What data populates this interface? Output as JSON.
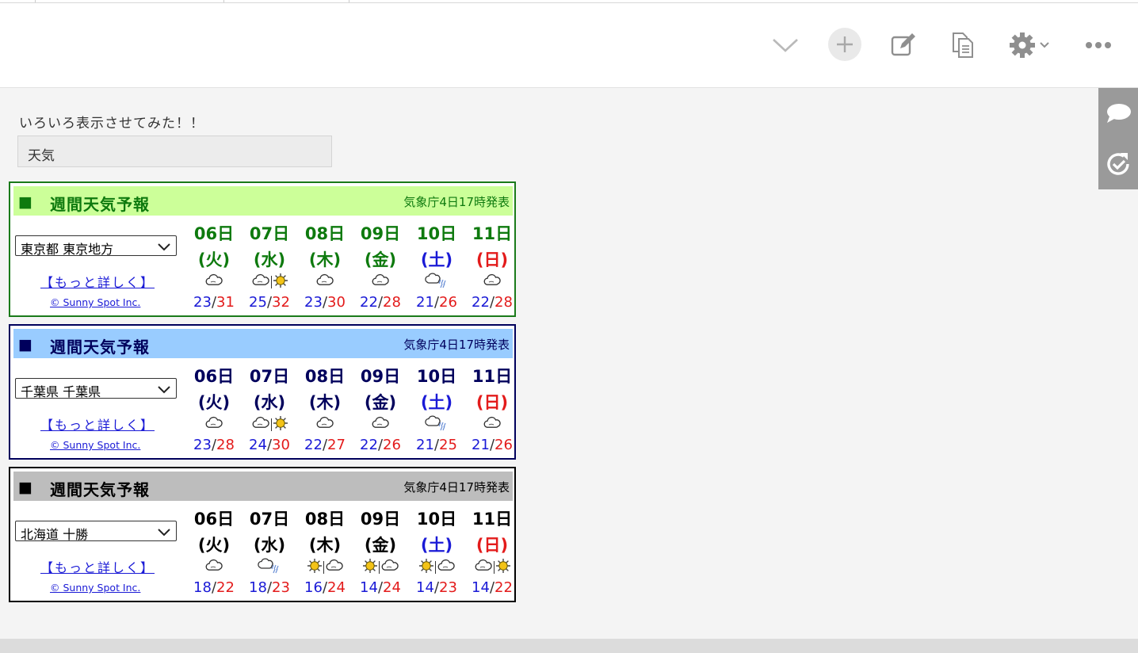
{
  "page": {
    "title": "いろいろ表示させてみた！！",
    "search_value": "天気"
  },
  "toolbar": {
    "icons": [
      "chevron-down-icon",
      "plus-icon",
      "edit-icon",
      "document-icon",
      "gear-icon",
      "more-icon"
    ]
  },
  "side_panel": {
    "icons": [
      "comment-icon",
      "refresh-icon"
    ]
  },
  "colors": {
    "green_border": "#1a7a1a",
    "green_header": "#ccff99",
    "green_text": "#0e7a0e",
    "navy_border": "#00005c",
    "blue_header": "#99ccff",
    "navy_text": "#00005c",
    "black_border": "#000000",
    "gray_header": "#bdbdbd",
    "low_temp": "#1a1ad6",
    "high_temp": "#e31b1b"
  },
  "widgets": [
    {
      "square": "■",
      "title": "週間天気予報",
      "issuer": "気象庁4日17時発表",
      "region": "東京都 東京地方",
      "more_link": "【もっと詳しく】",
      "copyright": "© Sunny Spot Inc.",
      "days": [
        {
          "date": "06日",
          "dow": "(火)",
          "dow_type": "weekday",
          "weather": [
            "cloud"
          ],
          "low": "23",
          "high": "31"
        },
        {
          "date": "07日",
          "dow": "(水)",
          "dow_type": "weekday",
          "weather": [
            "cloud",
            "sun"
          ],
          "low": "25",
          "high": "32"
        },
        {
          "date": "08日",
          "dow": "(木)",
          "dow_type": "weekday",
          "weather": [
            "cloud"
          ],
          "low": "23",
          "high": "30"
        },
        {
          "date": "09日",
          "dow": "(金)",
          "dow_type": "weekday",
          "weather": [
            "cloud"
          ],
          "low": "22",
          "high": "28"
        },
        {
          "date": "10日",
          "dow": "(土)",
          "dow_type": "saturday",
          "weather": [
            "cloud-rain"
          ],
          "low": "21",
          "high": "26"
        },
        {
          "date": "11日",
          "dow": "(日)",
          "dow_type": "sunday",
          "weather": [
            "cloud"
          ],
          "low": "22",
          "high": "28"
        }
      ]
    },
    {
      "square": "■",
      "title": "週間天気予報",
      "issuer": "気象庁4日17時発表",
      "region": "千葉県 千葉県",
      "more_link": "【もっと詳しく】",
      "copyright": "© Sunny Spot Inc.",
      "days": [
        {
          "date": "06日",
          "dow": "(火)",
          "dow_type": "weekday",
          "weather": [
            "cloud"
          ],
          "low": "23",
          "high": "28"
        },
        {
          "date": "07日",
          "dow": "(水)",
          "dow_type": "weekday",
          "weather": [
            "cloud",
            "sun"
          ],
          "low": "24",
          "high": "30"
        },
        {
          "date": "08日",
          "dow": "(木)",
          "dow_type": "weekday",
          "weather": [
            "cloud"
          ],
          "low": "22",
          "high": "27"
        },
        {
          "date": "09日",
          "dow": "(金)",
          "dow_type": "weekday",
          "weather": [
            "cloud"
          ],
          "low": "22",
          "high": "26"
        },
        {
          "date": "10日",
          "dow": "(土)",
          "dow_type": "saturday",
          "weather": [
            "cloud-rain"
          ],
          "low": "21",
          "high": "25"
        },
        {
          "date": "11日",
          "dow": "(日)",
          "dow_type": "sunday",
          "weather": [
            "cloud"
          ],
          "low": "21",
          "high": "26"
        }
      ]
    },
    {
      "square": "■",
      "title": "週間天気予報",
      "issuer": "気象庁4日17時発表",
      "region": "北海道 十勝",
      "more_link": "【もっと詳しく】",
      "copyright": "© Sunny Spot Inc.",
      "days": [
        {
          "date": "06日",
          "dow": "(火)",
          "dow_type": "weekday",
          "weather": [
            "cloud"
          ],
          "low": "18",
          "high": "22"
        },
        {
          "date": "07日",
          "dow": "(水)",
          "dow_type": "weekday",
          "weather": [
            "cloud-rain"
          ],
          "low": "18",
          "high": "23"
        },
        {
          "date": "08日",
          "dow": "(木)",
          "dow_type": "weekday",
          "weather": [
            "sun",
            "cloud"
          ],
          "low": "16",
          "high": "24"
        },
        {
          "date": "09日",
          "dow": "(金)",
          "dow_type": "weekday",
          "weather": [
            "sun",
            "cloud"
          ],
          "low": "14",
          "high": "24"
        },
        {
          "date": "10日",
          "dow": "(土)",
          "dow_type": "saturday",
          "weather": [
            "sun",
            "cloud"
          ],
          "low": "14",
          "high": "23"
        },
        {
          "date": "11日",
          "dow": "(日)",
          "dow_type": "sunday",
          "weather": [
            "cloud",
            "sun"
          ],
          "low": "14",
          "high": "22"
        }
      ]
    }
  ]
}
